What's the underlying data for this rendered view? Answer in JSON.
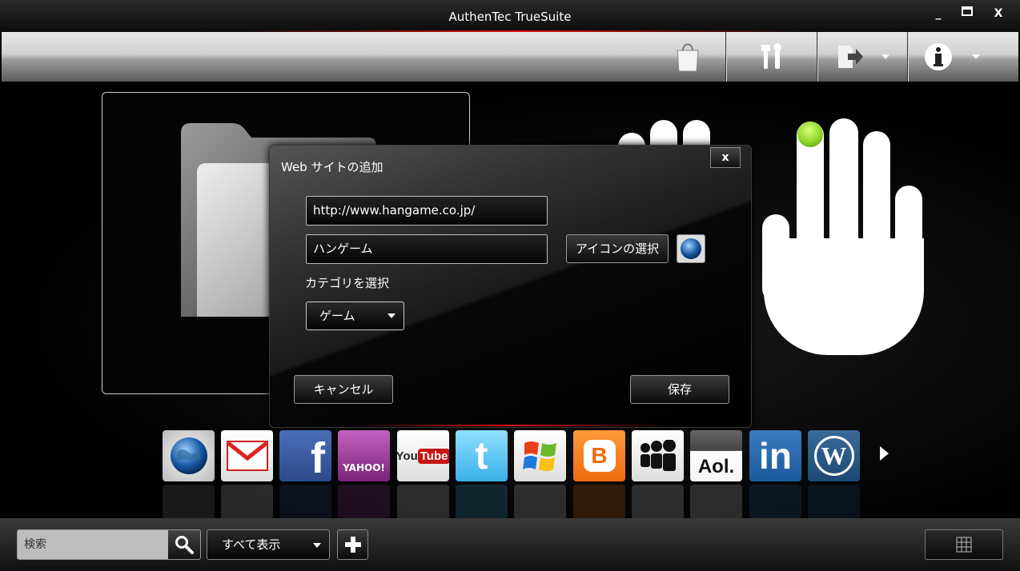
{
  "window": {
    "title": "AuthenTec TrueSuite",
    "minimize": "_",
    "maximize": "▀",
    "close": "X"
  },
  "toolbar": {
    "shop_icon": "shopping-bag-icon",
    "settings_icon": "tools-icon",
    "export_icon": "export-icon",
    "info_icon": "info-icon"
  },
  "dialog": {
    "title": "Web サイトの追加",
    "close_label": "x",
    "url_value": "http://www.hangame.co.jp/",
    "name_value": "ハンゲーム",
    "select_icon_label": "アイコンの選択",
    "category_label": "カテゴリを選択",
    "category_selected": "ゲーム",
    "cancel_label": "キャンセル",
    "save_label": "保存"
  },
  "apps": [
    {
      "name": "globe",
      "label": ""
    },
    {
      "name": "gmail",
      "label": ""
    },
    {
      "name": "facebook",
      "label": "f"
    },
    {
      "name": "yahoo",
      "label": "YAHOO!"
    },
    {
      "name": "youtube",
      "label": "You Tube"
    },
    {
      "name": "twitter",
      "label": "t"
    },
    {
      "name": "windows",
      "label": ""
    },
    {
      "name": "blogger",
      "label": "B"
    },
    {
      "name": "myspace",
      "label": ""
    },
    {
      "name": "aol",
      "label": "Aol."
    },
    {
      "name": "linkedin",
      "label": "in"
    },
    {
      "name": "wordpress",
      "label": "W"
    }
  ],
  "bottom": {
    "search_placeholder": "検索",
    "filter_selected": "すべて表示",
    "add_label": "+"
  },
  "colors": {
    "accent_red": "#e01010",
    "finger_indicator": "#8fd62a"
  }
}
